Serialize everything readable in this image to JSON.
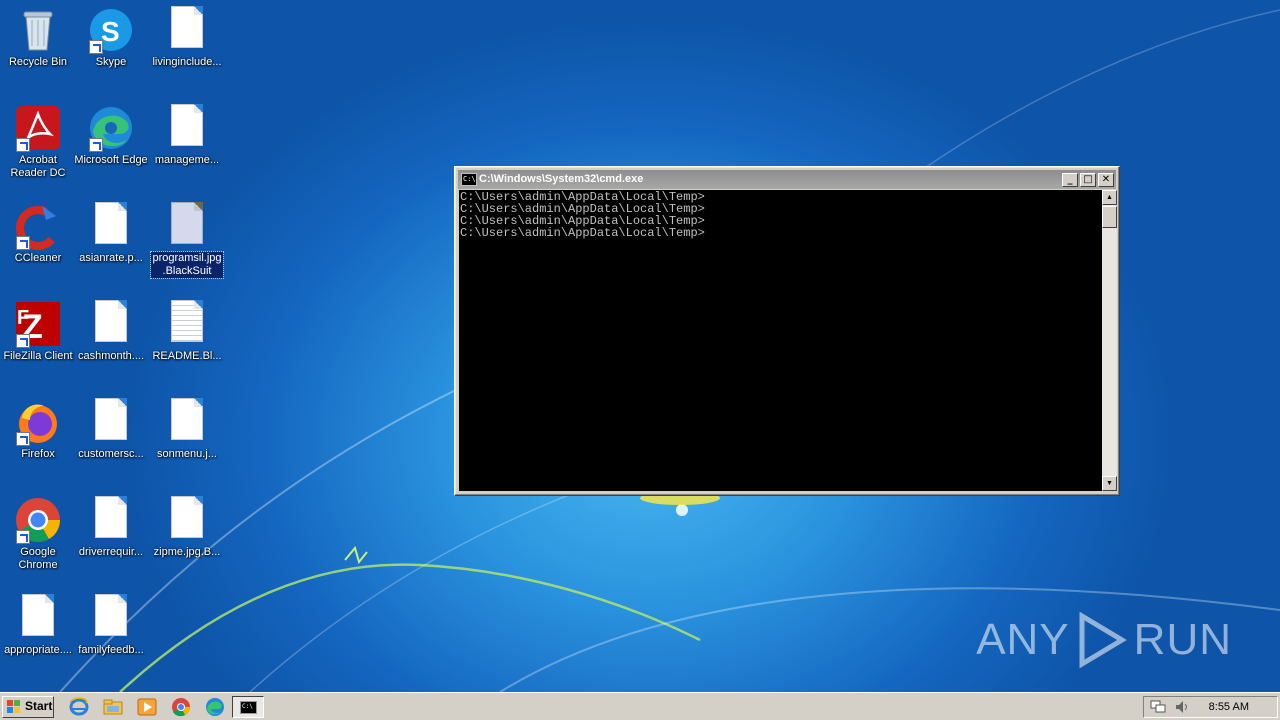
{
  "desktop": {
    "icons": [
      {
        "label": "Recycle Bin",
        "icon": "recycle-bin-icon"
      },
      {
        "label": "Skype",
        "icon": "skype-icon"
      },
      {
        "label": "livinginclude...",
        "icon": "document-icon"
      },
      {
        "label": "Acrobat\nReader DC",
        "icon": "acrobat-reader-icon"
      },
      {
        "label": "Microsoft Edge",
        "icon": "edge-icon"
      },
      {
        "label": "manageme...",
        "icon": "document-icon"
      },
      {
        "label": "CCleaner",
        "icon": "ccleaner-icon"
      },
      {
        "label": "asianrate.p...",
        "icon": "document-icon"
      },
      {
        "label": "programsil.jpg\n.BlackSuit",
        "icon": "encrypted-file-icon",
        "selected": true
      },
      {
        "label": "FileZilla Client",
        "icon": "filezilla-icon"
      },
      {
        "label": "cashmonth....",
        "icon": "document-icon"
      },
      {
        "label": "README.Bl...",
        "icon": "text-file-icon"
      },
      {
        "label": "Firefox",
        "icon": "firefox-icon"
      },
      {
        "label": "customersc...",
        "icon": "document-icon"
      },
      {
        "label": "sonmenu.j...",
        "icon": "document-icon"
      },
      {
        "label": "Google\nChrome",
        "icon": "chrome-icon"
      },
      {
        "label": "driverrequir...",
        "icon": "document-icon"
      },
      {
        "label": "zipme.jpg.B...",
        "icon": "document-icon"
      },
      {
        "label": "appropriate....",
        "icon": "document-icon"
      },
      {
        "label": "familyfeedb...",
        "icon": "document-icon"
      }
    ]
  },
  "cmd_window": {
    "title": "C:\\Windows\\System32\\cmd.exe",
    "icon_text": "C:\\",
    "minimize": "_",
    "maximize": "□",
    "close": "✕",
    "lines": [
      "C:\\Users\\admin\\AppData\\Local\\Temp>",
      "C:\\Users\\admin\\AppData\\Local\\Temp>",
      "C:\\Users\\admin\\AppData\\Local\\Temp>",
      "C:\\Users\\admin\\AppData\\Local\\Temp>"
    ]
  },
  "watermark": {
    "left": "ANY",
    "right": "RUN"
  },
  "taskbar": {
    "start_label": "Start",
    "quick_launch": [
      "internet-explorer-icon",
      "file-explorer-icon",
      "media-player-icon",
      "chrome-icon",
      "edge-icon"
    ],
    "running_task_icon": "C:\\",
    "clock": "8:55 AM"
  }
}
